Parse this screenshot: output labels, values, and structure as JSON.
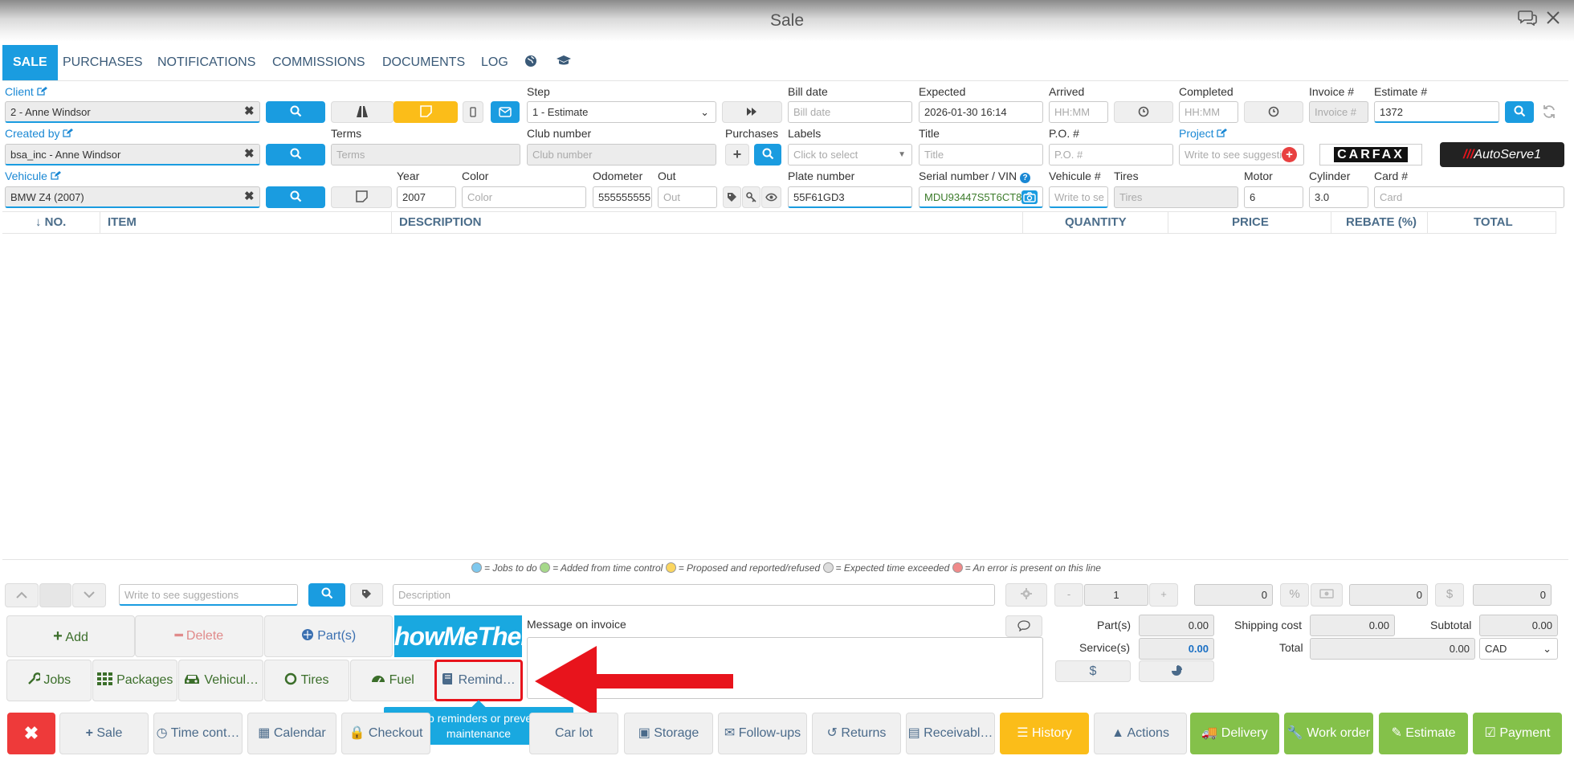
{
  "window": {
    "title": "Sale"
  },
  "tabs": [
    {
      "label": "SALE"
    },
    {
      "label": "PURCHASES"
    },
    {
      "label": "NOTIFICATIONS"
    },
    {
      "label": "COMMISSIONS"
    },
    {
      "label": "DOCUMENTS"
    },
    {
      "label": "LOG"
    }
  ],
  "labels": {
    "client": "Client",
    "step": "Step",
    "bill_date": "Bill date",
    "expected": "Expected",
    "arrived": "Arrived",
    "completed": "Completed",
    "invoice_no": "Invoice #",
    "estimate_no": "Estimate #",
    "created_by": "Created by",
    "terms": "Terms",
    "club_number": "Club number",
    "purchases": "Purchases",
    "labels": "Labels",
    "title": "Title",
    "po": "P.O. #",
    "project": "Project",
    "vehicle": "Vehicule",
    "year": "Year",
    "color": "Color",
    "odometer": "Odometer",
    "out": "Out",
    "plate": "Plate number",
    "serial": "Serial number / VIN",
    "vehicle_no": "Vehicule #",
    "tires": "Tires",
    "motor": "Motor",
    "cylinder": "Cylinder",
    "card": "Card #"
  },
  "fields": {
    "client": "2 - Anne Windsor",
    "step": "1 - Estimate",
    "bill_date_ph": "Bill date",
    "expected": "2026-01-30 16:14",
    "arrived_ph": "HH:MM",
    "completed_ph": "HH:MM",
    "invoice_ph": "Invoice #",
    "estimate": "1372",
    "created_by": "bsa_inc - Anne Windsor",
    "terms_ph": "Terms",
    "club_ph": "Club number",
    "labels_ph": "Click to select",
    "title_ph": "Title",
    "po_ph": "P.O. #",
    "project_ph": "Write to see suggestio",
    "vehicle": "BMW Z4 (2007)",
    "year": "2007",
    "color_ph": "Color",
    "odometer": "555555555",
    "out_ph": "Out",
    "plate": "55F61GD3",
    "serial": "MDU93447S5T6CT8",
    "vehicle_no_ph": "Write to se",
    "tires_ph": "Tires",
    "motor": "6",
    "cylinder": "3.0",
    "card_ph": "Card"
  },
  "brands": {
    "carfax": "CARFAX",
    "autoserve": "AutoServe1"
  },
  "table": {
    "columns": [
      "↓ NO.",
      "ITEM",
      "DESCRIPTION",
      "QUANTITY",
      "PRICE",
      "REBATE (%)",
      "TOTAL"
    ]
  },
  "legend": [
    {
      "color": "#7ec8ee",
      "text": "= Jobs to do"
    },
    {
      "color": "#a6d98a",
      "text": "= Added from time control"
    },
    {
      "color": "#fbd660",
      "text": "= Proposed and reported/refused"
    },
    {
      "color": "#dddddd",
      "text": "= Expected time exceeded"
    },
    {
      "color": "#f08a8a",
      "text": "= An error is present on this line"
    }
  ],
  "entry": {
    "suggest_ph": "Write to see suggestions",
    "description_ph": "Description",
    "minus": "-",
    "qty": "1",
    "plus": "+",
    "price": "0",
    "pct": "%",
    "rebate": "0",
    "dollar": "$",
    "total": "0"
  },
  "actions": {
    "add": "Add",
    "delete": "Delete",
    "parts": "Part(s)",
    "promo": "howMeTheP",
    "jobs": "Jobs",
    "packages": "Packages",
    "vehicles": "Vehicul…",
    "tires": "Tires",
    "fuel": "Fuel",
    "reminders": "Remind…"
  },
  "message": {
    "label": "Message on invoice"
  },
  "totals": {
    "parts_label": "Part(s)",
    "parts": "0.00",
    "services_label": "Service(s)",
    "services": "0.00",
    "shipping_label": "Shipping cost",
    "shipping": "0.00",
    "subtotal_label": "Subtotal",
    "subtotal": "0.00",
    "total_label": "Total",
    "total": "0.00",
    "currency": "CAD",
    "dollar": "$"
  },
  "tooltip": {
    "text": "Set up reminders or preventive maintenance"
  },
  "bottom": {
    "sale": "Sale",
    "time": "Time cont…",
    "calendar": "Calendar",
    "checkout": "Checkout",
    "carlot": "Car lot",
    "storage": "Storage",
    "followups": "Follow-ups",
    "returns": "Returns",
    "receivables": "Receivabl…",
    "history": "History",
    "actions": "Actions",
    "delivery": "Delivery",
    "workorder": "Work order",
    "estimate": "Estimate",
    "payment": "Payment"
  },
  "colors": {
    "accent": "#1a9ce0",
    "yellow": "#fbbd19",
    "green": "#84c14a",
    "red": "#ee3a3a",
    "highlight": "#e8141c"
  }
}
